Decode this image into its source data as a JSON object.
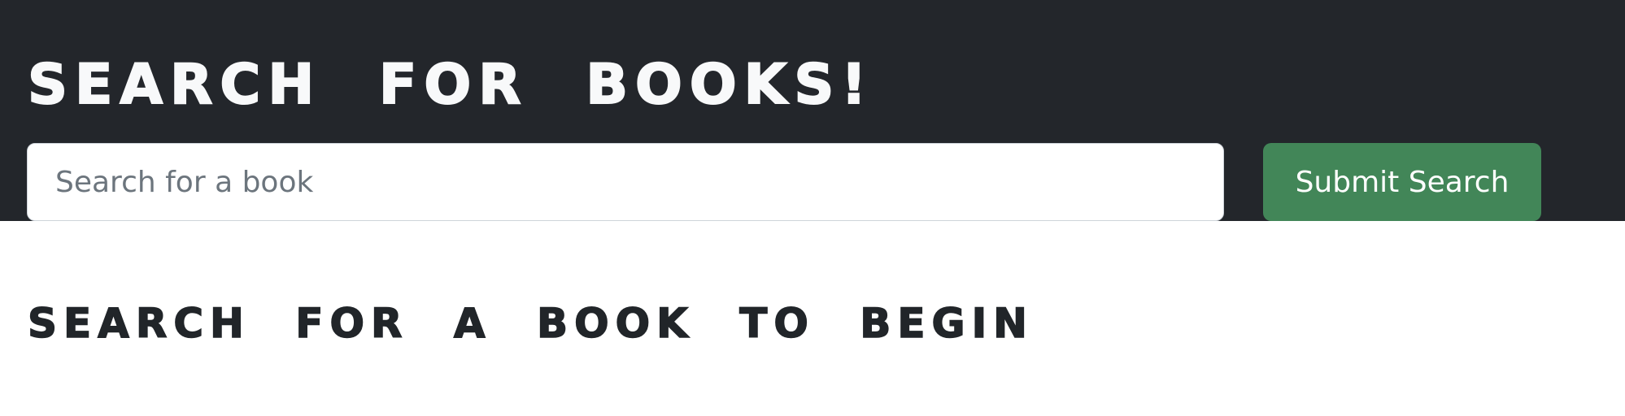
{
  "header": {
    "title": "SEARCH FOR BOOKS!"
  },
  "search": {
    "input_value": "",
    "placeholder": "Search for a book",
    "submit_label": "Submit Search"
  },
  "results": {
    "empty_message": "SEARCH FOR A BOOK TO BEGIN"
  },
  "colors": {
    "header_background": "#23262b",
    "submit_button": "#428658",
    "page_background": "#ffffff",
    "heading_text_dark": "#212529",
    "heading_text_light": "#f8f9fa"
  }
}
